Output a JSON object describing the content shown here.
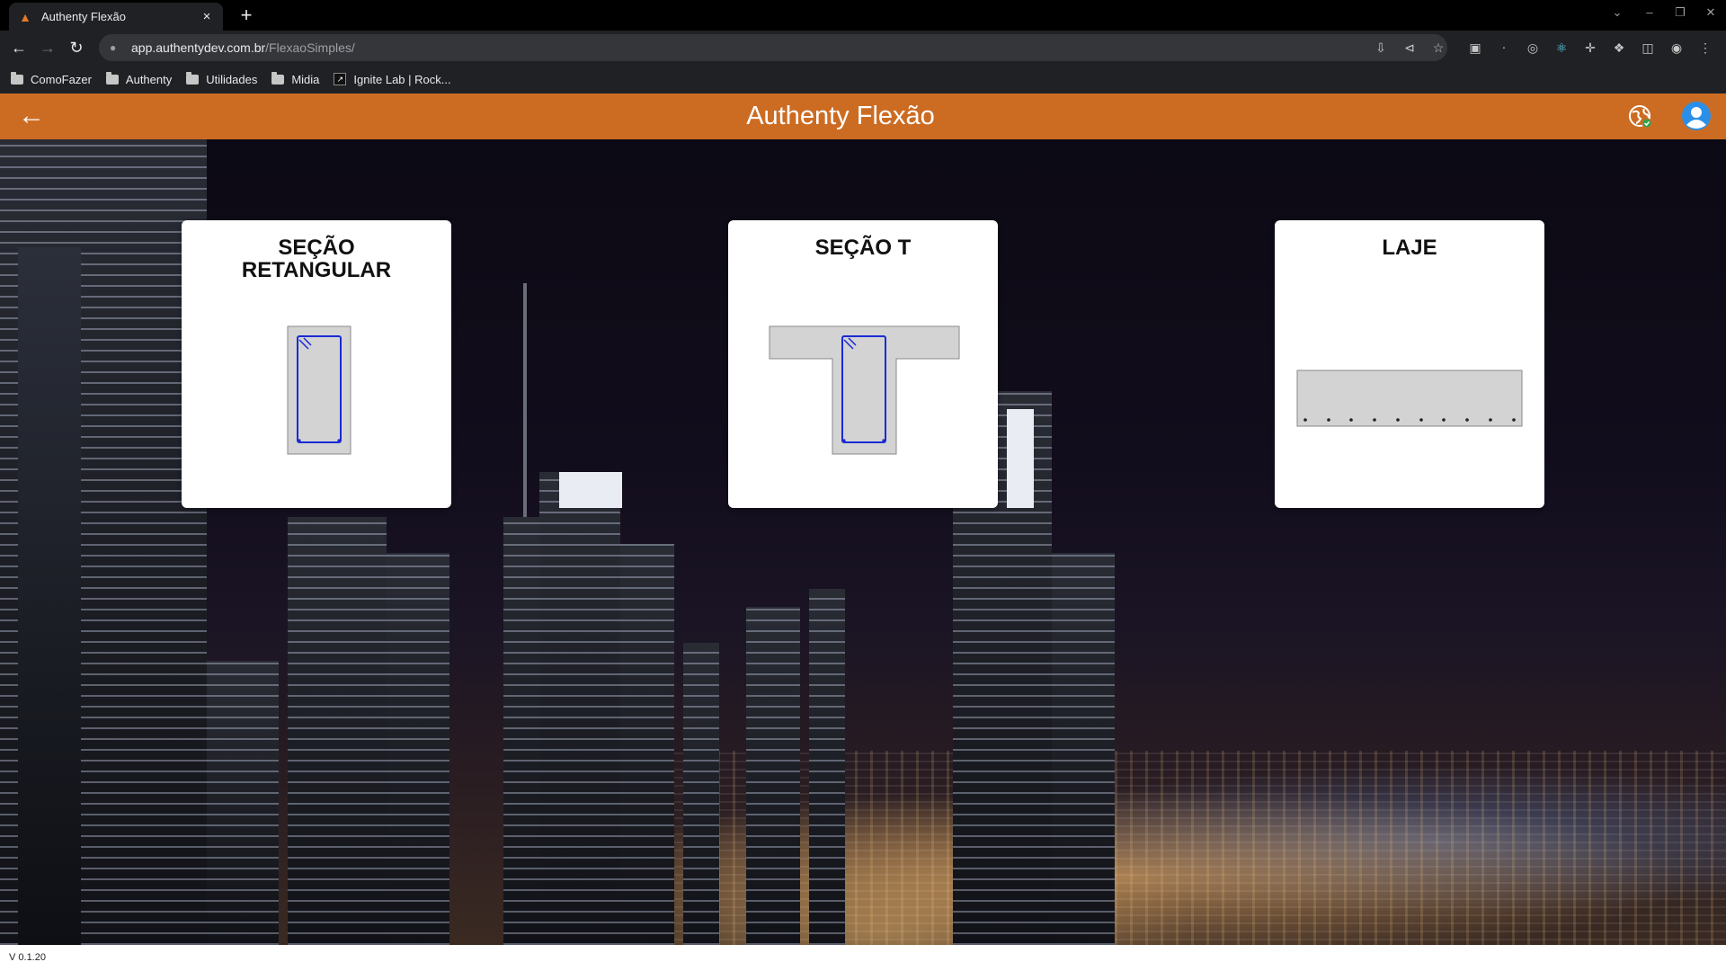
{
  "browser": {
    "tab_title": "Authenty Flexão",
    "tab_close": "×",
    "new_tab": "+",
    "url_host": "app.authentydev.com.br",
    "url_path": "/FlexaoSimples/",
    "bookmarks": [
      {
        "label": "ComoFazer",
        "icon": "folder-icon"
      },
      {
        "label": "Authenty",
        "icon": "folder-icon"
      },
      {
        "label": "Utilidades",
        "icon": "folder-icon"
      },
      {
        "label": "Midia",
        "icon": "folder-icon"
      },
      {
        "label": "Ignite Lab | Rock...",
        "icon": "ignite-lab-icon"
      }
    ]
  },
  "app": {
    "title": "Authenty Flexão",
    "header_color": "#cc6c23",
    "back_icon": "arrow-left-icon",
    "language_icon": "globe-icon",
    "user_icon": "user-avatar-icon"
  },
  "cards": [
    {
      "title": "SEÇÃO RETANGULAR",
      "diagram": "rectangular-section"
    },
    {
      "title": "SEÇÃO T",
      "diagram": "t-section"
    },
    {
      "title": "LAJE",
      "diagram": "slab"
    }
  ],
  "footer": {
    "version": "V 0.1.20"
  }
}
